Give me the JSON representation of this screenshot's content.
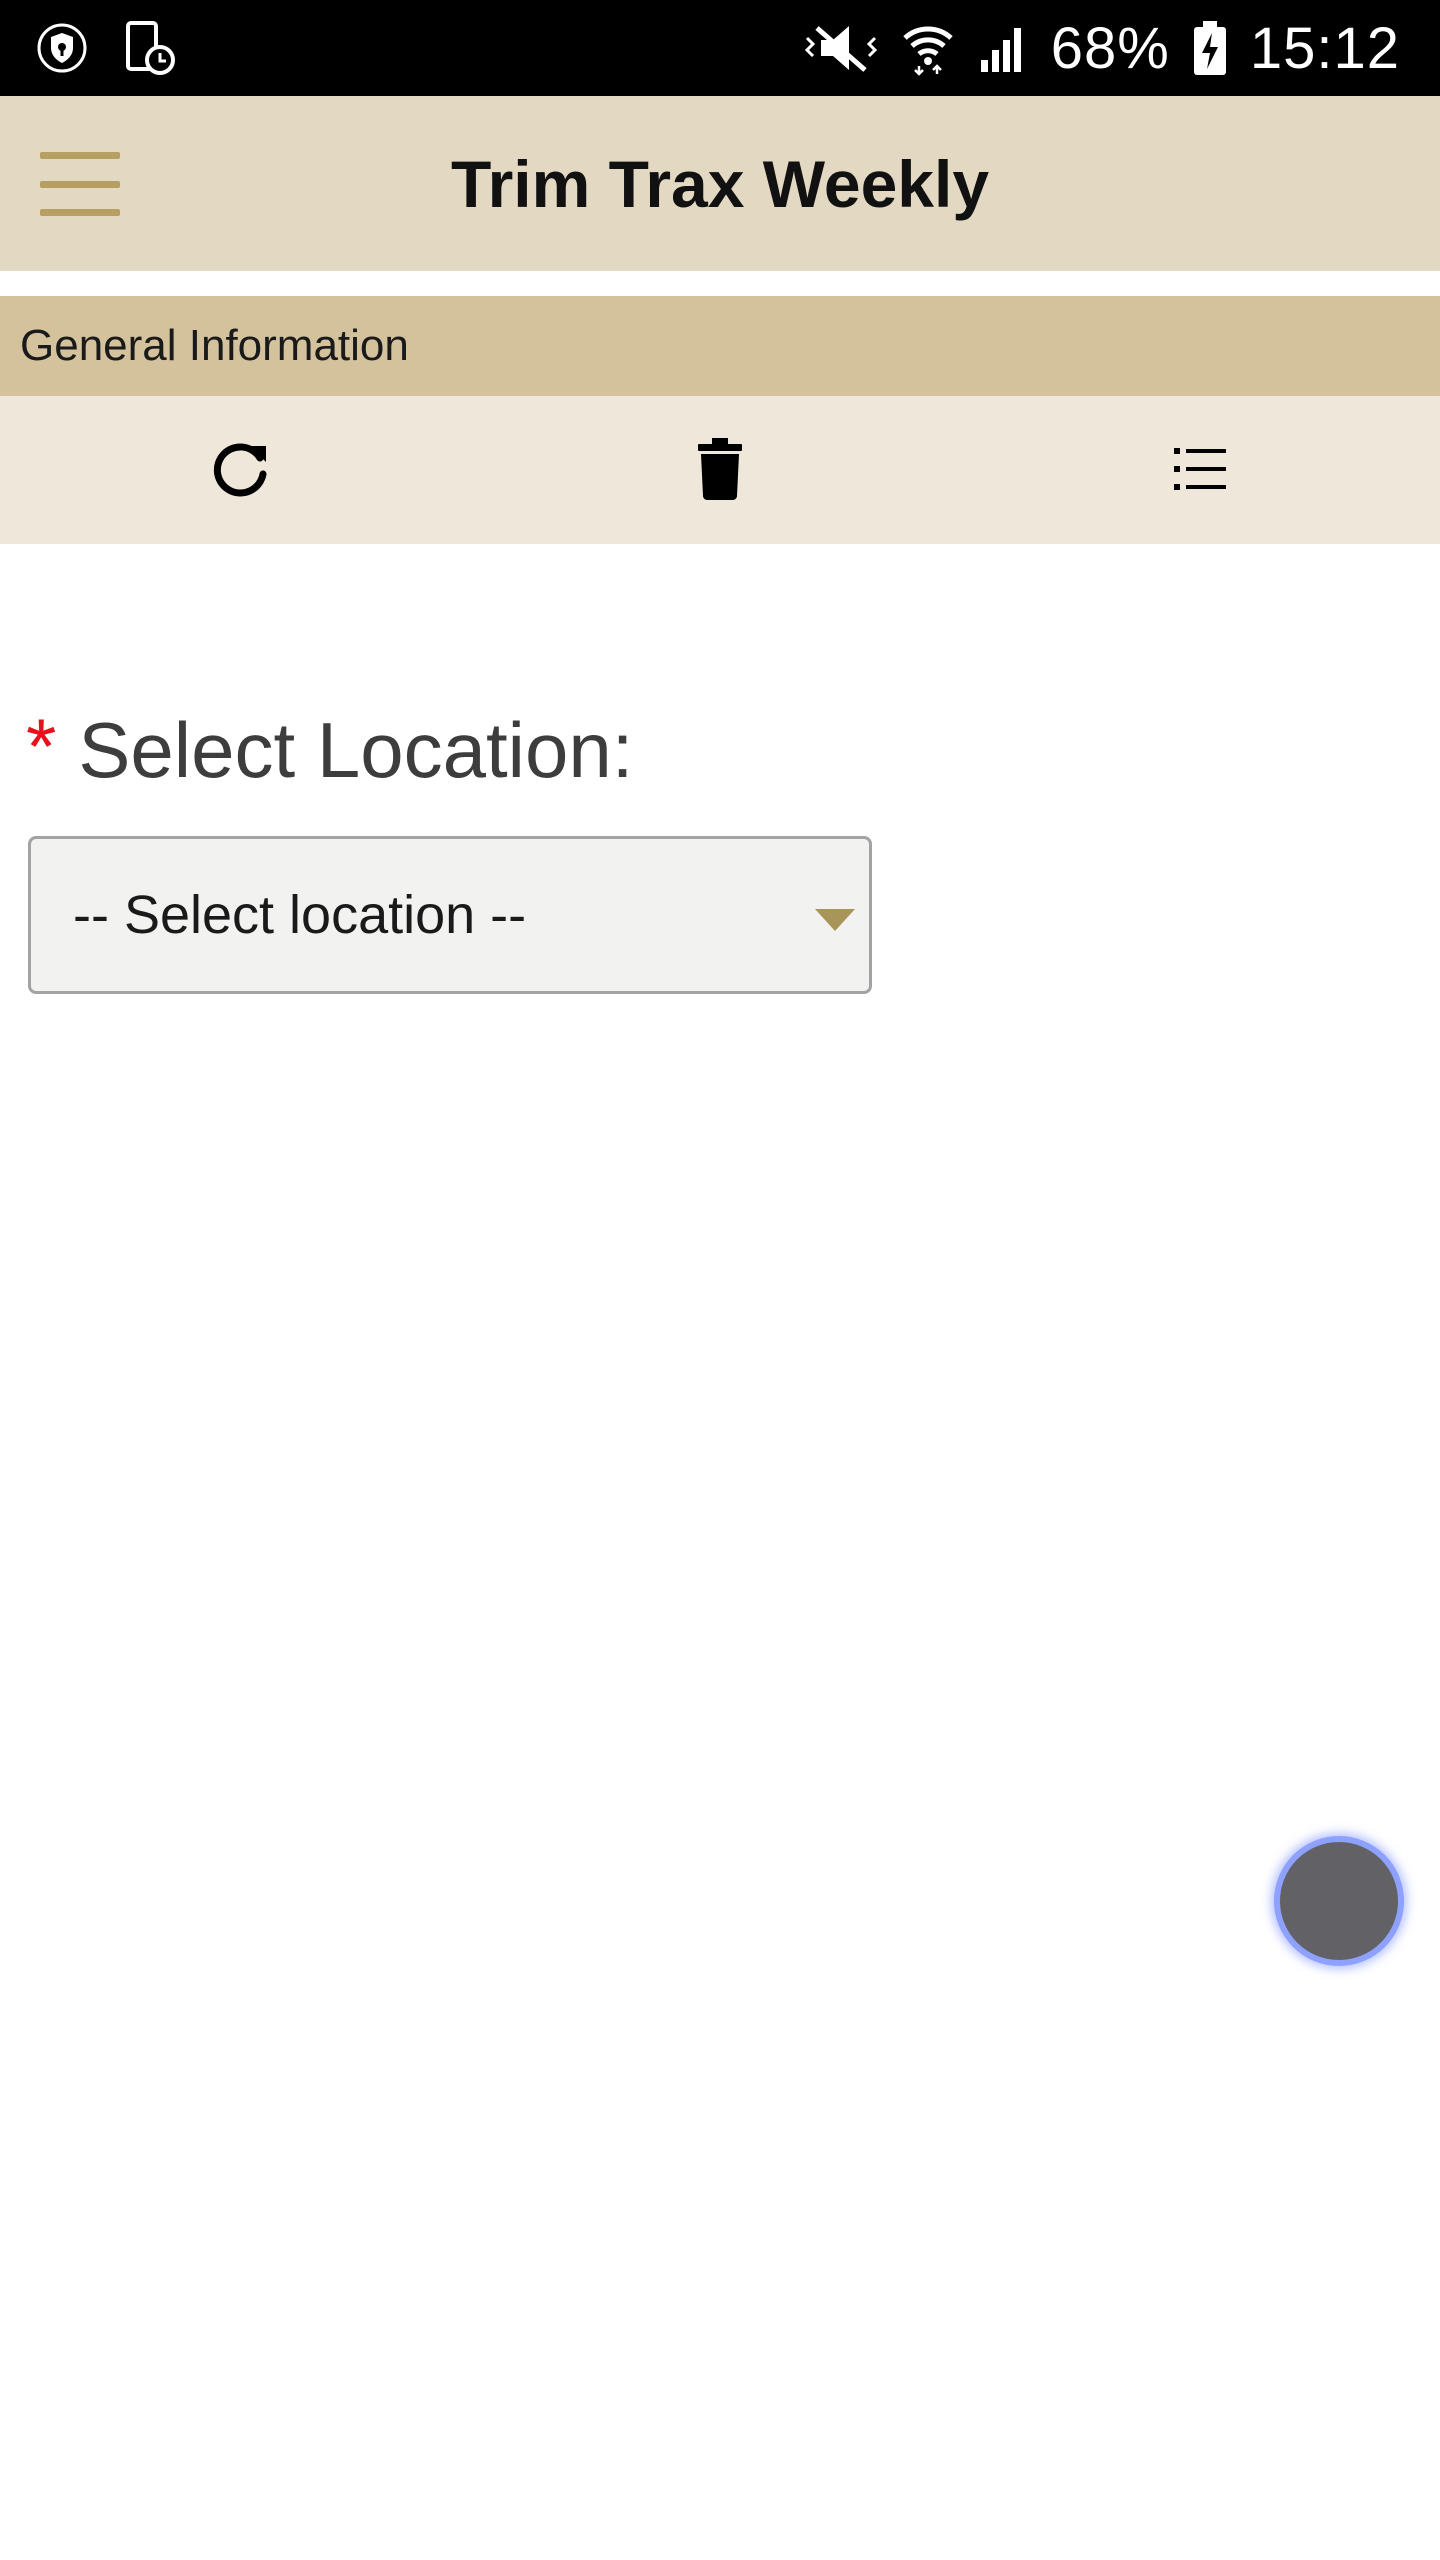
{
  "status_bar": {
    "battery_percent": "68%",
    "time": "15:12",
    "icons": [
      "shield-icon",
      "device-clock-icon",
      "vibrate-mute-icon",
      "wifi-icon",
      "cell-signal-icon",
      "battery-charging-icon"
    ]
  },
  "header": {
    "title": "Trim Trax Weekly",
    "menu_icon": "hamburger-menu-icon"
  },
  "section": {
    "title": "General Information"
  },
  "toolbar": {
    "buttons": [
      "refresh-icon",
      "trash-icon",
      "list-icon"
    ]
  },
  "form": {
    "location_label": "Select Location:",
    "required_marker": "*",
    "location_select": {
      "selected": "-- Select location --"
    }
  },
  "colors": {
    "header_bg": "#e3d9c2",
    "section_bg": "#d3c29c",
    "toolbar_bg": "#efe7d9",
    "accent": "#b79e62",
    "required": "#e8101a"
  }
}
